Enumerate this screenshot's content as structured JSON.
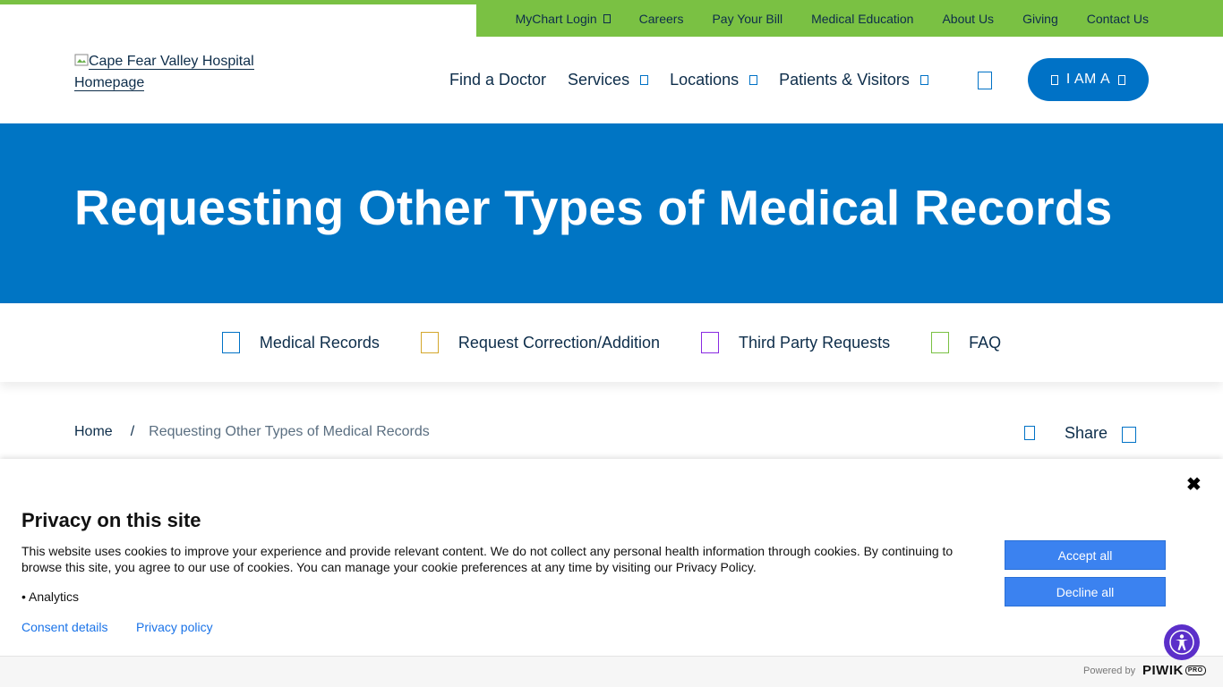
{
  "colors": {
    "brand_green": "#7ac143",
    "brand_blue": "#0075c4",
    "text_navy": "#0d2d4a",
    "consent_blue": "#3b82f0",
    "a11y_purple": "#5b2fc9"
  },
  "utility_nav": {
    "items": [
      {
        "label": "MyChart Login",
        "has_icon": true
      },
      {
        "label": "Careers",
        "has_icon": false
      },
      {
        "label": "Pay Your Bill",
        "has_icon": false
      },
      {
        "label": "Medical Education",
        "has_icon": false
      },
      {
        "label": "About Us",
        "has_icon": false
      },
      {
        "label": "Giving",
        "has_icon": false
      },
      {
        "label": "Contact Us",
        "has_icon": false
      }
    ]
  },
  "header": {
    "logo_alt": "Cape Fear Valley Hospital Homepage",
    "nav": [
      {
        "label": "Find a Doctor"
      },
      {
        "label": "Services"
      },
      {
        "label": "Locations"
      },
      {
        "label": "Patients & Visitors"
      }
    ],
    "search_icon": "search-icon",
    "iam_label": "I AM A"
  },
  "hero": {
    "title": "Requesting Other Types of Medical Records"
  },
  "quick_links": [
    {
      "label": "Medical Records",
      "icon": "document-icon",
      "icon_color": "#0072c6"
    },
    {
      "label": "Request Correction/Addition",
      "icon": "edit-icon",
      "icon_color": "#d4a72c"
    },
    {
      "label": "Third Party Requests",
      "icon": "users-icon",
      "icon_color": "#8a2be2"
    },
    {
      "label": "FAQ",
      "icon": "question-icon",
      "icon_color": "#7ac143"
    }
  ],
  "breadcrumb": {
    "home": "Home",
    "separator": "/",
    "current": "Requesting Other Types of Medical Records"
  },
  "share": {
    "label": "Share"
  },
  "consent": {
    "close_glyph": "✖",
    "title": "Privacy on this site",
    "text": "This website uses cookies to improve your experience and provide relevant content. We do not collect any personal health information through cookies. By continuing to browse this site, you agree to our use of cookies. You can manage your cookie preferences at any time by visiting our Privacy Policy.",
    "bullet": "• Analytics",
    "links": {
      "details": "Consent details",
      "policy": "Privacy policy"
    },
    "accept_label": "Accept all",
    "decline_label": "Decline all",
    "powered_by": "Powered by",
    "brand": "PIWIK",
    "brand_suffix": "PRO"
  }
}
